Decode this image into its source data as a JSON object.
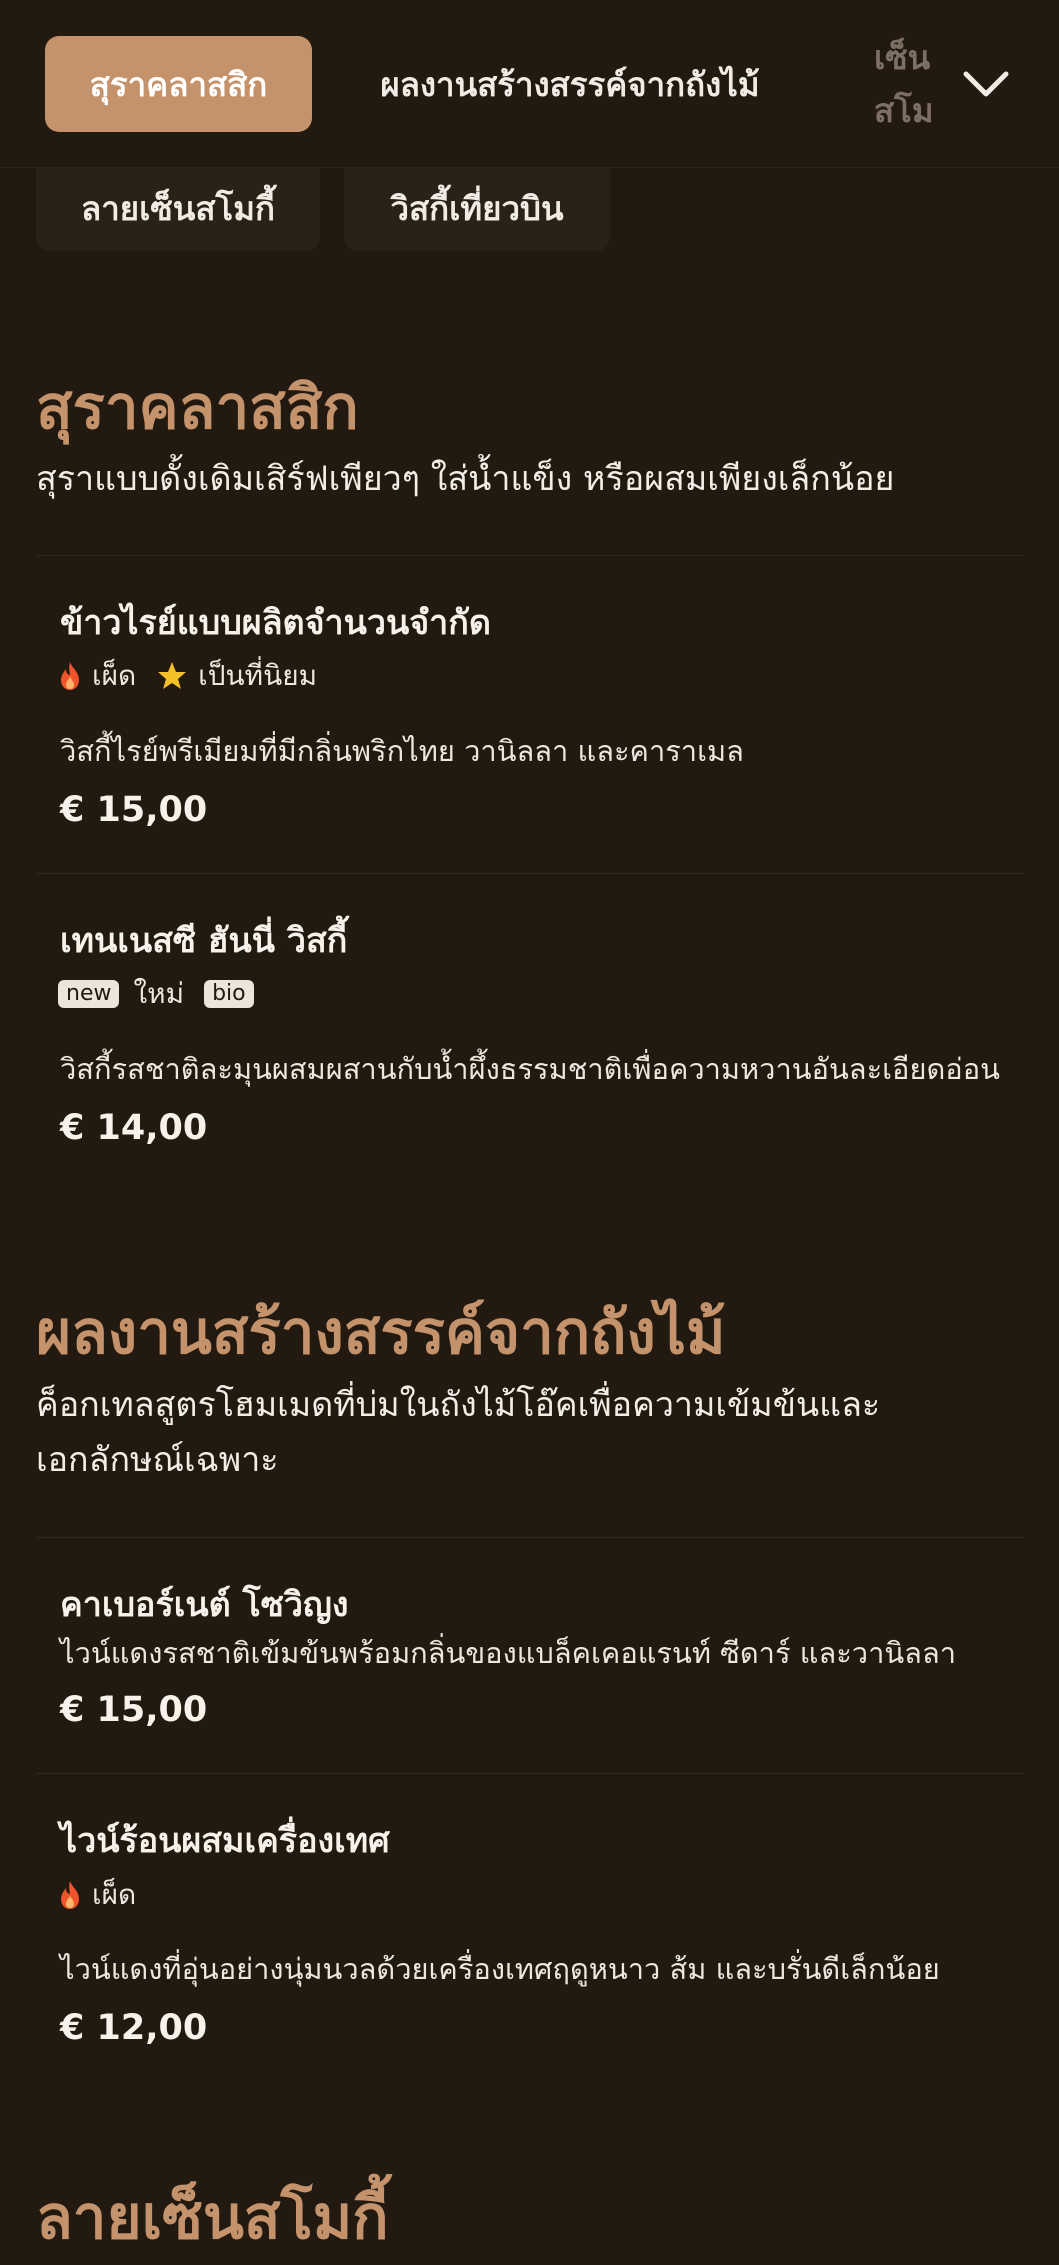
{
  "nav": {
    "tabs": [
      {
        "label": "สุราคลาสสิก",
        "active": true
      },
      {
        "label": "ผลงานสร้างสรรค์จากถังไม้",
        "active": false
      },
      {
        "label": "ลายเซ็นสโมกี้",
        "active": false
      }
    ],
    "chips": [
      {
        "label": "ลายเซ็นสโมกี้"
      },
      {
        "label": "วิสกี้เที่ยวบิน"
      }
    ],
    "expand_icon": "chevron-down-icon"
  },
  "sections": [
    {
      "title": "สุราคลาสสิก",
      "description": "สุราแบบดั้งเดิมเสิร์ฟเพียวๆ ใส่น้ำแข็ง หรือผสมเพียงเล็กน้อย",
      "items": [
        {
          "name": "ข้าวไรย์แบบผลิตจำนวนจำกัด",
          "tags": {
            "spicy": "เผ็ด",
            "popular": "เป็นที่นิยม"
          },
          "description": "วิสกี้ไรย์พรีเมียมที่มีกลิ่นพริกไทย วานิลลา และคาราเมล",
          "price": "€ 15,00"
        },
        {
          "name": "เทนเนสซี ฮันนี่ วิสกี้",
          "tags": {
            "new_badge": "new",
            "new": "ใหม่",
            "bio_badge": "bio"
          },
          "description": "วิสกี้รสชาติละมุนผสมผสานกับน้ำผึ้งธรรมชาติเพื่อความหวานอันละเอียดอ่อน",
          "price": "€ 14,00"
        }
      ]
    },
    {
      "title": "ผลงานสร้างสรรค์จากถังไม้",
      "description_lines": [
        "ค็อกเทลสูตรโฮมเมดที่บ่มในถังไม้โอ๊คเพื่อความเข้มข้นและ",
        "เอกลักษณ์เฉพาะ"
      ],
      "items": [
        {
          "name": "คาเบอร์เนต์ โซวิญง",
          "description": "ไวน์แดงรสชาติเข้มข้นพร้อมกลิ่นของแบล็คเคอแรนท์ ซีดาร์ และวานิลลา",
          "price": "€ 15,00"
        },
        {
          "name": "ไวน์ร้อนผสมเครื่องเทศ",
          "tags": {
            "spicy": "เผ็ด"
          },
          "description": "ไวน์แดงที่อุ่นอย่างนุ่มนวลด้วยเครื่องเทศฤดูหนาว ส้ม และบรั่นดีเล็กน้อย",
          "price": "€ 12,00"
        }
      ]
    },
    {
      "title": "ลายเซ็นสโมกี้"
    }
  ],
  "colors": {
    "background": "#221911",
    "accent": "#c4926b",
    "spicy": "#f0542a",
    "star": "#f4c02a"
  }
}
